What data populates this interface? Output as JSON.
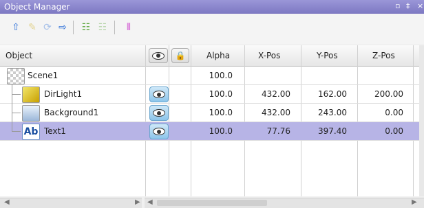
{
  "window": {
    "title": "Object Manager"
  },
  "toolbar": {
    "icons": [
      "arrow-up-icon",
      "pencil-icon",
      "link-icon",
      "arrow-right-icon",
      "tree-expand-icon",
      "tree-collapse-icon",
      "split-icon"
    ]
  },
  "columns": {
    "object": "Object",
    "visible_icon": "eye-icon",
    "lock_icon": "lock-icon",
    "alpha": "Alpha",
    "xpos": "X-Pos",
    "ypos": "Y-Pos",
    "zpos": "Z-Pos"
  },
  "rows": [
    {
      "name": "Scene1",
      "icon": "scene-icon",
      "visible_toggle": false,
      "alpha": "100.0",
      "xpos": "",
      "ypos": "",
      "zpos": "",
      "selected": false
    },
    {
      "name": "DirLight1",
      "icon": "light-icon",
      "visible_toggle": true,
      "alpha": "100.0",
      "xpos": "432.00",
      "ypos": "162.00",
      "zpos": "200.00",
      "selected": false
    },
    {
      "name": "Background1",
      "icon": "background-icon",
      "visible_toggle": true,
      "alpha": "100.0",
      "xpos": "432.00",
      "ypos": "243.00",
      "zpos": "0.00",
      "selected": false
    },
    {
      "name": "Text1",
      "icon": "text-icon",
      "icon_label": "Ab",
      "visible_toggle": true,
      "alpha": "100.0",
      "xpos": "77.76",
      "ypos": "397.40",
      "zpos": "0.00",
      "selected": true
    }
  ],
  "colors": {
    "titlebar": "#8a86cc",
    "selection": "#b7b4e6",
    "eye_button": "#8cc5eb"
  }
}
